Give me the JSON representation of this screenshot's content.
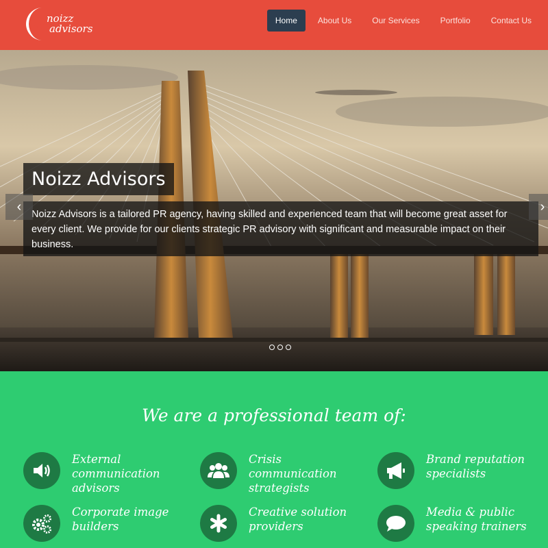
{
  "header": {
    "logo": {
      "line1": "noizz",
      "line2": "advisors",
      "icon": "crescent-logo-icon"
    },
    "nav": [
      {
        "label": "Home",
        "active": true
      },
      {
        "label": "About Us",
        "active": false
      },
      {
        "label": "Our Services",
        "active": false
      },
      {
        "label": "Portfolio",
        "active": false
      },
      {
        "label": "Contact Us",
        "active": false
      }
    ]
  },
  "hero": {
    "title": "Noizz Advisors",
    "text": "Noizz Advisors is a tailored PR agency, having skilled and experienced team that will become great asset for every client. We provide for our clients strategic PR advisory with significant and measurable impact on their business.",
    "prev_icon": "chevron-left-icon",
    "next_icon": "chevron-right-icon",
    "prev": "‹",
    "next": "›",
    "slide_count": 3
  },
  "services": {
    "title": "We are a professional team of:",
    "items": [
      {
        "label": "External communication advisors",
        "icon": "volume-icon"
      },
      {
        "label": "Crisis communication strategists",
        "icon": "group-icon"
      },
      {
        "label": "Brand reputation specialists",
        "icon": "megaphone-icon"
      },
      {
        "label": "Corporate image builders",
        "icon": "gears-icon"
      },
      {
        "label": "Creative solution providers",
        "icon": "asterisk-icon"
      },
      {
        "label": "Media & public speaking trainers",
        "icon": "speech-bubble-icon"
      }
    ]
  },
  "colors": {
    "header": "#e74c3c",
    "nav_active": "#2c3e50",
    "services_bg": "#2ecc71",
    "icon_bg": "#1e7a44"
  }
}
